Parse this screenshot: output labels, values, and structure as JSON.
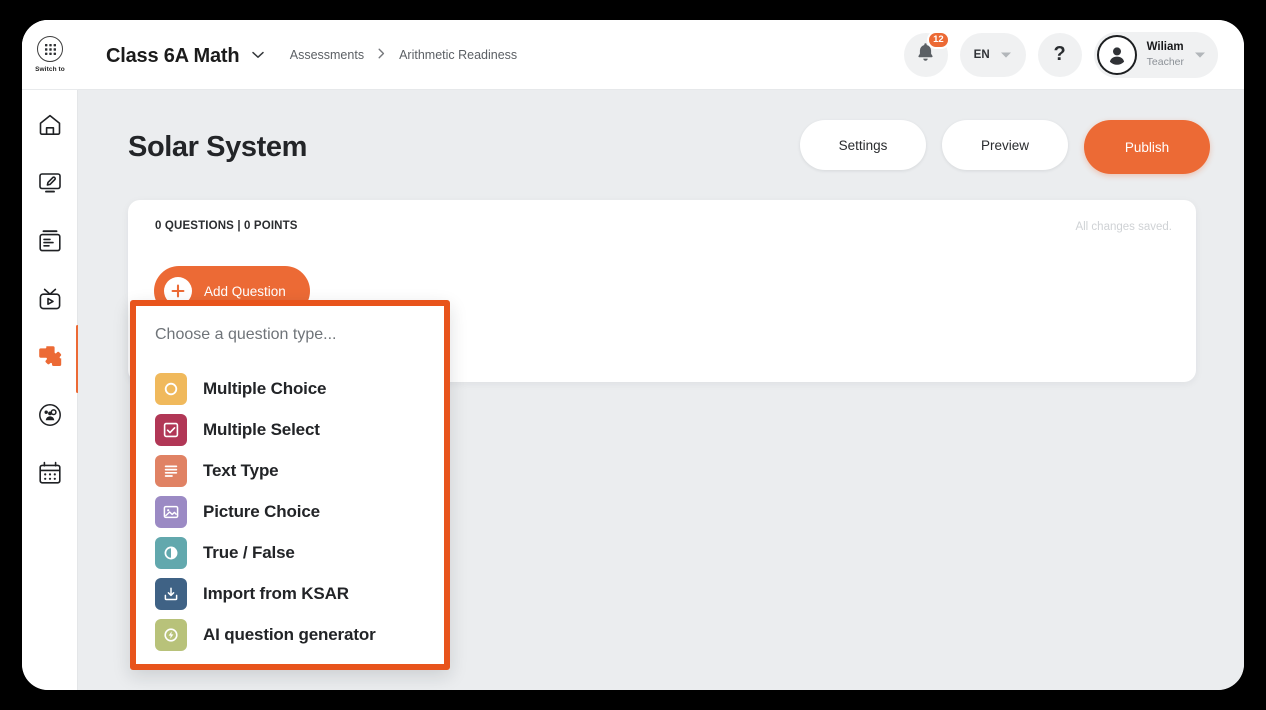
{
  "topbar": {
    "switch_to_label": "Switch to",
    "class_name": "Class 6A Math",
    "breadcrumb": [
      "Assessments",
      "Arithmetic Readiness"
    ],
    "breadcrumb_separator": "›",
    "notifications_badge": "12",
    "language": "EN",
    "help_glyph": "?",
    "user_name": "Wiliam",
    "user_role": "Teacher"
  },
  "sidebar": {
    "items": [
      {
        "name": "home",
        "label": "Home",
        "active": false
      },
      {
        "name": "whiteboard",
        "label": "Whiteboard",
        "active": false
      },
      {
        "name": "articles",
        "label": "Articles",
        "active": false
      },
      {
        "name": "videos",
        "label": "Videos",
        "active": false
      },
      {
        "name": "assessments",
        "label": "Assessments",
        "active": true
      },
      {
        "name": "classes",
        "label": "Classes",
        "active": false
      },
      {
        "name": "calendar",
        "label": "Calendar",
        "active": false
      }
    ],
    "active_color": "#ec6a35"
  },
  "page": {
    "title": "Solar System",
    "actions": {
      "settings": "Settings",
      "preview": "Preview",
      "publish": "Publish"
    }
  },
  "builder": {
    "meta": "0 QUESTIONS | 0 POINTS",
    "saved_status": "All changes saved.",
    "add_question": "Add Question"
  },
  "question_type_dropdown": {
    "placeholder": "Choose a question type...",
    "highlight_color": "#e8541c",
    "options": [
      {
        "label": "Multiple Choice",
        "icon": "radio-icon",
        "color": "#f0b95c"
      },
      {
        "label": "Multiple Select",
        "icon": "checkbox-icon",
        "color": "#b13756"
      },
      {
        "label": "Text Type",
        "icon": "text-lines-icon",
        "color": "#e08264"
      },
      {
        "label": "Picture Choice",
        "icon": "image-icon",
        "color": "#9b8ac4"
      },
      {
        "label": "True / False",
        "icon": "half-circle-icon",
        "color": "#62a8ad"
      },
      {
        "label": "Import from KSAR",
        "icon": "import-icon",
        "color": "#3f6285"
      },
      {
        "label": "AI question generator",
        "icon": "ai-sparkle-icon",
        "color": "#b8c27a"
      }
    ]
  },
  "theme": {
    "brand_orange": "#ec6a35",
    "page_bg": "#ebedef",
    "card_bg": "#ffffff"
  }
}
